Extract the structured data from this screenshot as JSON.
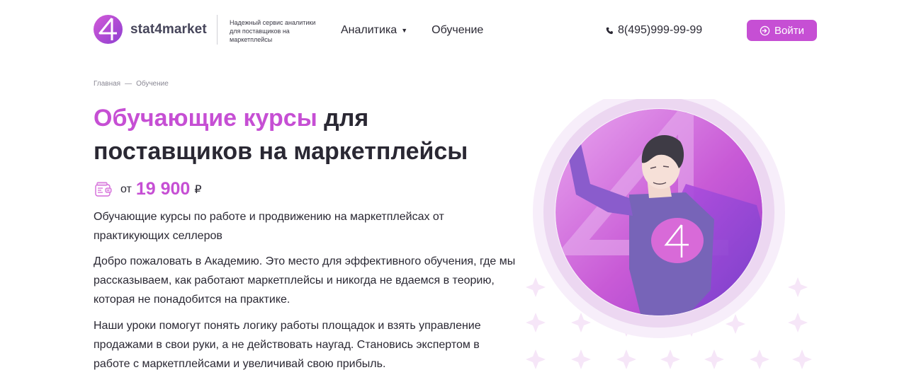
{
  "header": {
    "logo_text": "stat4market",
    "tagline": "Надежный сервис аналитики для поставщиков на маркетплейсы",
    "nav": [
      {
        "label": "Аналитика",
        "has_dropdown": true
      },
      {
        "label": "Обучение",
        "has_dropdown": false
      }
    ],
    "phone": "8(495)999-99-99",
    "login_label": "Войти"
  },
  "breadcrumb": {
    "home": "Главная",
    "separator": "—",
    "current": "Обучение"
  },
  "hero": {
    "title_accent": "Обучающие курсы",
    "title_rest": " для поставщиков на маркетплейсы",
    "price_prefix": "от",
    "price_value": "19 900",
    "price_currency": "₽",
    "paragraphs": [
      "Обучающие курсы по работе и продвижению на маркетплейсах от практикующих селлеров",
      "Добро пожаловать в Академию. Это место для эффективного обучения, где мы рассказываем, как работают маркетплейсы и никогда не вдаемся в теорию, которая не понадобится на практике.",
      "Наши уроки помогут понять логику работы площадок и взять управление продажами в свои руки, а не действовать наугад. Становись экспертом в работе с маркетплейсами и увеличивай свою прибыль."
    ]
  },
  "colors": {
    "accent": "#c64fd4",
    "text": "#2a2833",
    "muted": "#8a8894"
  },
  "icons": [
    "logo-four-icon",
    "chevron-down-icon",
    "phone-icon",
    "login-icon",
    "wallet-icon",
    "superhero-illustration"
  ]
}
